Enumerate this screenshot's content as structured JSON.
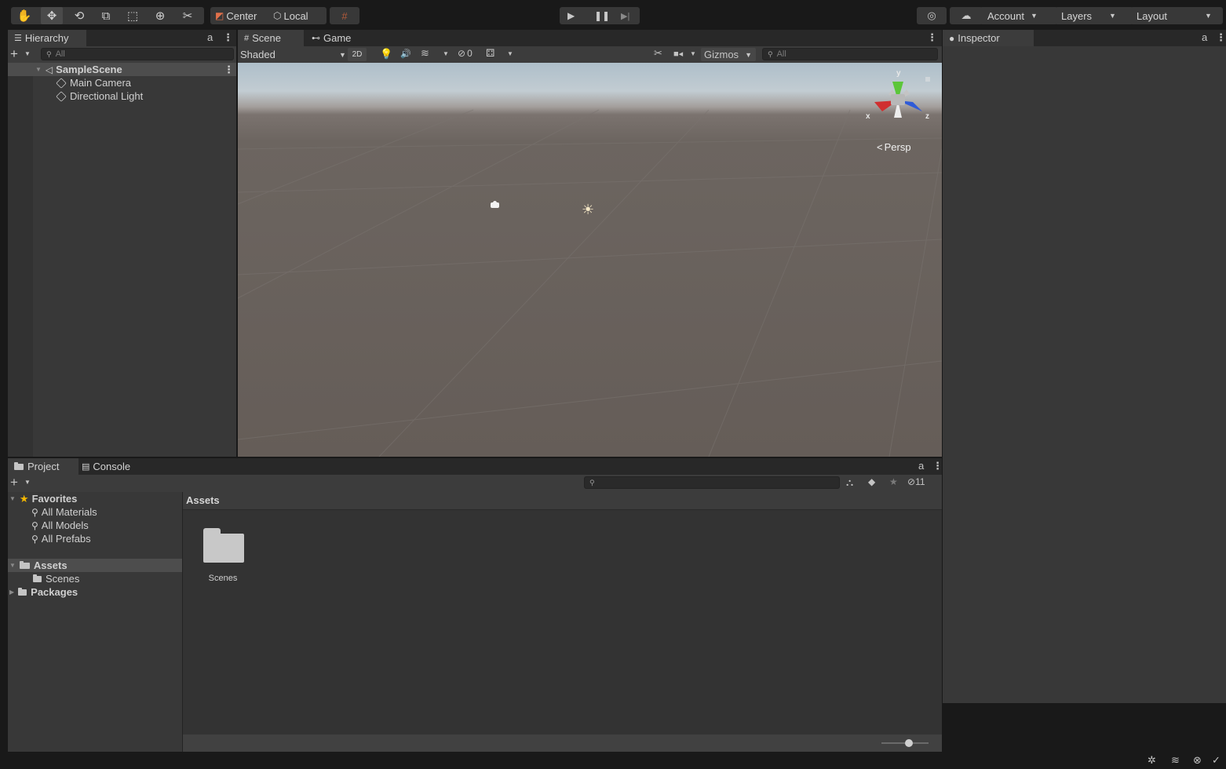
{
  "toolbar": {
    "tools": [
      {
        "icon": "hand-icon",
        "glyph": "✋"
      },
      {
        "icon": "move-icon",
        "glyph": "✥"
      },
      {
        "icon": "rotate-icon",
        "glyph": "⟲"
      },
      {
        "icon": "scale-icon",
        "glyph": "⧉"
      },
      {
        "icon": "rect-icon",
        "glyph": "⬚"
      },
      {
        "icon": "transform-icon",
        "glyph": "⊕"
      },
      {
        "icon": "custom-tool-icon",
        "glyph": "✂"
      }
    ],
    "pivot_label": "Center",
    "space_label": "Local",
    "account_label": "Account",
    "layers_label": "Layers",
    "layout_label": "Layout"
  },
  "hierarchy": {
    "tab_label": "Hierarchy",
    "search_placeholder": "All",
    "scene_name": "SampleScene",
    "items": [
      "Main Camera",
      "Directional Light"
    ]
  },
  "scene_view": {
    "tabs": [
      "Scene",
      "Game"
    ],
    "shading_mode": "Shaded",
    "mode_2d": "2D",
    "hidden_count": "0",
    "gizmos_label": "Gizmos",
    "search_placeholder": "All",
    "axis_x": "x",
    "axis_y": "y",
    "axis_z": "z",
    "projection_label": "Persp"
  },
  "inspector": {
    "tab_label": "Inspector"
  },
  "project": {
    "tabs": [
      "Project",
      "Console"
    ],
    "hidden_count": "11",
    "favorites_label": "Favorites",
    "favorites": [
      "All Materials",
      "All Models",
      "All Prefabs"
    ],
    "assets_label": "Assets",
    "asset_children": [
      "Scenes"
    ],
    "packages_label": "Packages",
    "breadcrumb": "Assets",
    "grid_items": [
      "Scenes"
    ]
  },
  "colors": {
    "background": "#191919",
    "panel": "#383838",
    "tabbar": "#282828",
    "selection": "#4d4d4d",
    "favorites_star": "#f5b800",
    "gizmo_x": "#d03030",
    "gizmo_y": "#5cc63a",
    "gizmo_z": "#2f5bd8"
  }
}
